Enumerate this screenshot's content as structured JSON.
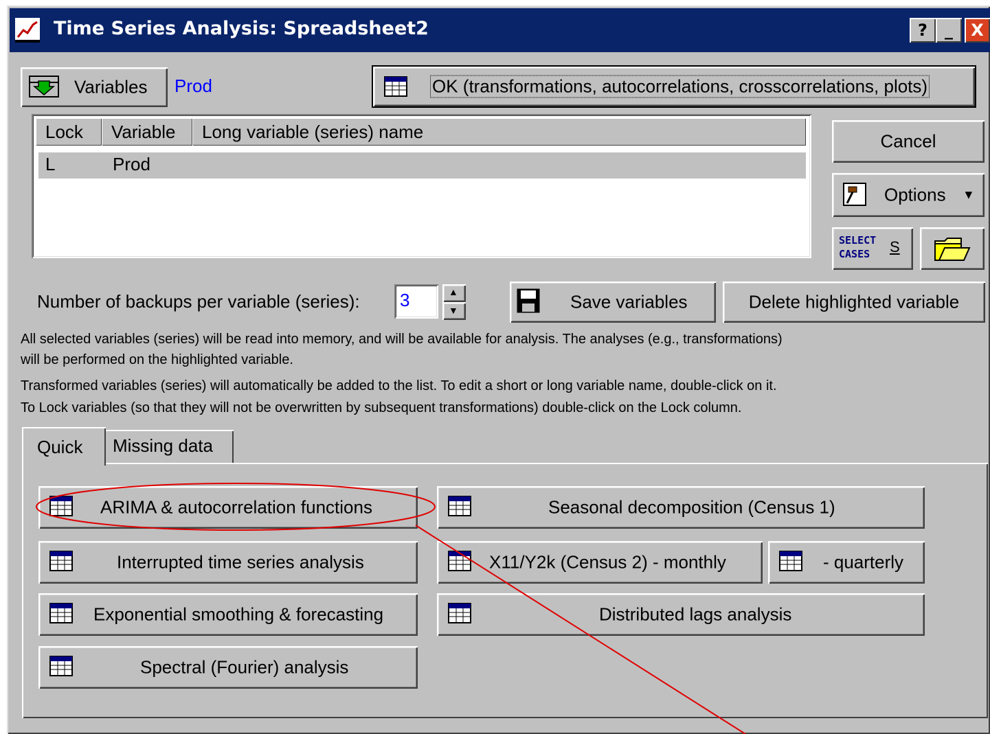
{
  "window": {
    "title": "Time Series Analysis: Spreadsheet2",
    "help_btn": "?",
    "min_btn": "_",
    "close_btn": "X"
  },
  "top": {
    "variables_button": "Variables",
    "selected_variable": "Prod",
    "ok_button": "OK (transformations, autocorrelations, crosscorrelations, plots)"
  },
  "table": {
    "columns": [
      "Lock",
      "Variable",
      "Long variable (series) name"
    ],
    "rows": [
      {
        "lock": "L",
        "variable": "Prod",
        "long_name": ""
      }
    ]
  },
  "side": {
    "cancel": "Cancel",
    "options": "Options",
    "select_cases_line1": "SELECT",
    "select_cases_line2": "CASES",
    "select_cases_s": "S"
  },
  "backups": {
    "label": "Number of backups per variable (series):",
    "value": "3",
    "save_variables": "Save variables",
    "delete_highlighted": "Delete highlighted variable"
  },
  "info": {
    "line1": "All selected variables (series) will be read into memory, and will be available for analysis. The analyses (e.g., transformations)",
    "line2": "will be performed on the highlighted variable.",
    "line3": "Transformed variables (series) will automatically be added to the list. To edit a short or long variable name, double-click on it.",
    "line4": "To Lock variables (so that they will not be overwritten by subsequent transformations) double-click on the Lock column."
  },
  "tabs": {
    "quick": "Quick",
    "missing": "Missing data"
  },
  "quick": {
    "arima": "ARIMA & autocorrelation functions",
    "interrupted": "Interrupted time series analysis",
    "exponential": "Exponential smoothing & forecasting",
    "spectral": "Spectral (Fourier) analysis",
    "seasonal": "Seasonal decomposition (Census 1)",
    "x11_monthly": "X11/Y2k (Census 2) - monthly",
    "quarterly": "- quarterly",
    "distributed": "Distributed lags analysis"
  },
  "colors": {
    "titlebar": "#0a246a",
    "face": "#c0c0c0",
    "link": "#0000ff",
    "annotation": "#e00000",
    "selected_row": "#c0c0c0"
  }
}
